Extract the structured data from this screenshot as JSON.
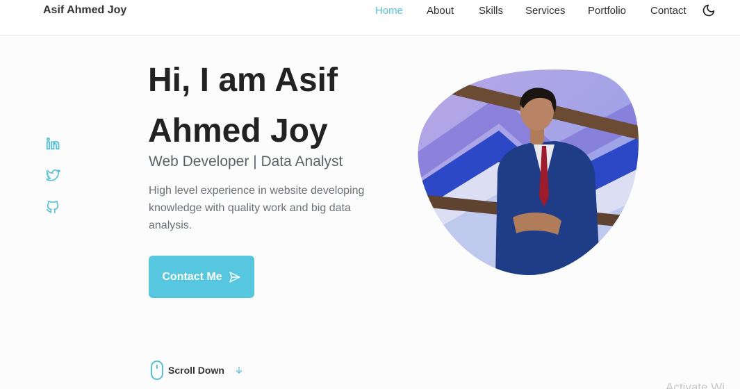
{
  "header": {
    "logo": "Asif Ahmed Joy",
    "nav": [
      {
        "label": "Home",
        "active": true
      },
      {
        "label": "About"
      },
      {
        "label": "Skills"
      },
      {
        "label": "Services"
      },
      {
        "label": "Portfolio"
      },
      {
        "label": "Contact"
      }
    ],
    "theme_icon": "moon-icon"
  },
  "social": [
    "linkedin-icon",
    "twitter-icon",
    "github-icon"
  ],
  "hero": {
    "title_line1": "Hi, I am Asif",
    "title_line2": "Ahmed Joy",
    "subtitle": "Web Developer | Data Analyst",
    "description": "High level experience in website developing knowledge with quality work and big data analysis.",
    "cta_label": "Contact Me"
  },
  "scroll": {
    "label": "Scroll Down"
  },
  "watermark": "Activate Wi",
  "colors": {
    "accent": "#55c0d8",
    "button": "#57c7e0",
    "text": "#222222"
  }
}
